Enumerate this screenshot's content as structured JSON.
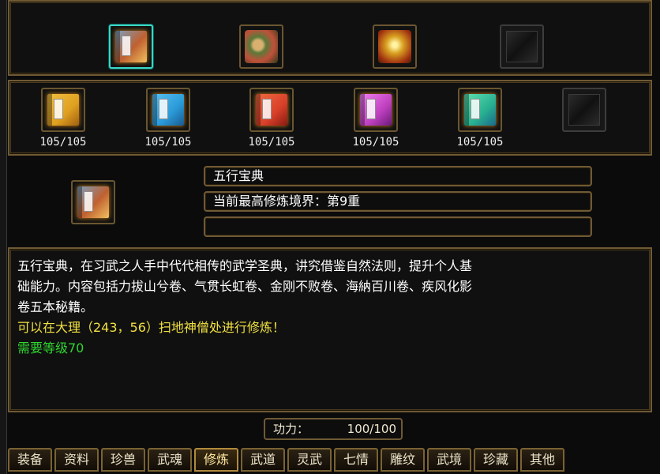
{
  "treasures": [
    {
      "name": "wuxing-book-icon",
      "selected": true,
      "colors": [
        "#7aa0c0",
        "#f0c060"
      ]
    },
    {
      "name": "scroll-bundle-icon",
      "selected": false,
      "colors": [
        "#5a7a3a",
        "#c0503a"
      ]
    },
    {
      "name": "golden-scrolls-icon",
      "selected": false,
      "colors": [
        "#d8a020",
        "#a03010"
      ]
    },
    {
      "name": "empty-slot",
      "selected": false,
      "colors": []
    }
  ],
  "volumes": [
    {
      "count": "105/105",
      "color": "#e0a020"
    },
    {
      "count": "105/105",
      "color": "#2a9ad8"
    },
    {
      "count": "105/105",
      "color": "#d8402a"
    },
    {
      "count": "105/105",
      "color": "#c040c0"
    },
    {
      "count": "105/105",
      "color": "#28b090"
    }
  ],
  "info": {
    "title": "五行宝典",
    "realm": "当前最高修炼境界：第9重",
    "extra": ""
  },
  "description": {
    "line1": "五行宝典，在习武之人手中代代相传的武学圣典，讲究借鉴自然法则，提升个人基",
    "line2": "础能力。内容包括力拔山兮卷、气贯长虹卷、金刚不败卷、海納百川卷、疾风化影",
    "line3": "卷五本秘籍。",
    "location": "可以在大理（243，56）扫地神僧处进行修炼！",
    "requirement": "需要等级70"
  },
  "power": {
    "label": "功力：",
    "value": "100/100"
  },
  "tabs": [
    "装备",
    "资料",
    "珍兽",
    "武魂",
    "修炼",
    "武道",
    "灵武",
    "七情",
    "雕纹",
    "武境",
    "珍藏",
    "其他"
  ],
  "active_tab": "修炼"
}
